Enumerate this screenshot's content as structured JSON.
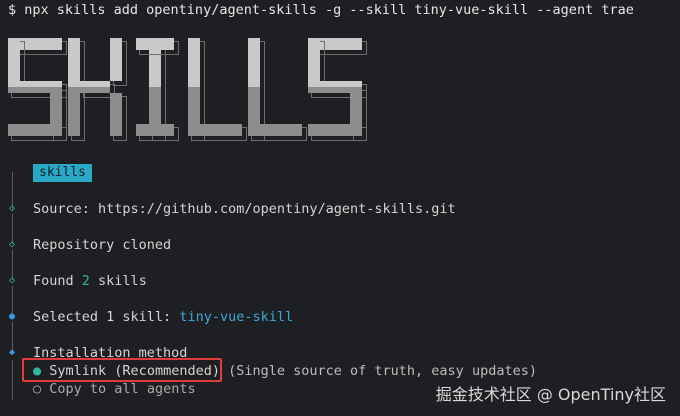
{
  "terminal": {
    "command": "$ npx skills add opentiny/agent-skills -g --skill tiny-vue-skill --agent trae"
  },
  "banner": {
    "text": "SKILLS"
  },
  "tree": {
    "tag": "skills",
    "source_label": "Source: ",
    "source_url": "https://github.com/opentiny/agent-skills.git",
    "cloned": "Repository cloned",
    "found_prefix": "Found ",
    "found_count": "2",
    "found_suffix": " skills",
    "selected_prefix": "Selected 1 skill: ",
    "selected_skill": "tiny-vue-skill",
    "install_title": "Installation method",
    "option_symlink": "Symlink (Recommended)",
    "option_symlink_hint": "(Single source of truth, easy updates)",
    "option_copy": "Copy to all agents"
  },
  "watermark": "掘金技术社区 @ OpenTiny社区",
  "colors": {
    "accent_green": "#2fb59c",
    "accent_cyan": "#3aa9d8",
    "highlight": "#e23b3b"
  }
}
